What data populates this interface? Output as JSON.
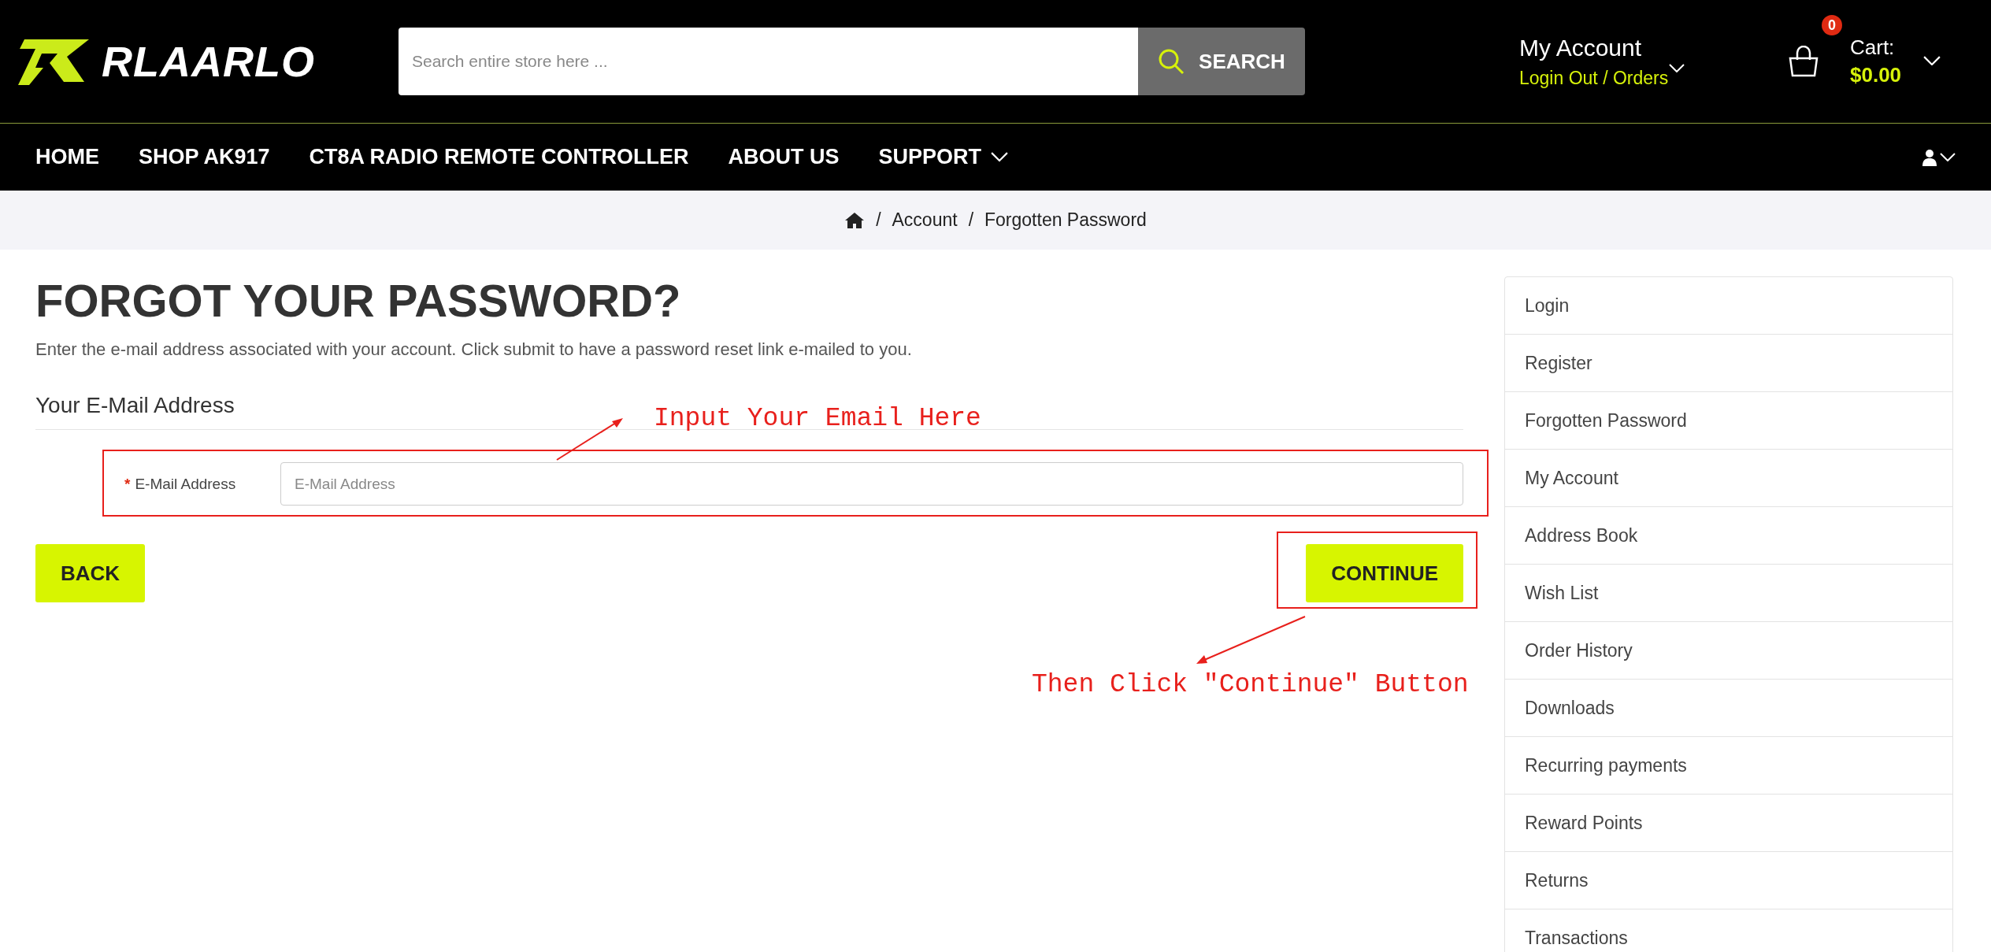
{
  "header": {
    "logo": {
      "text": "RLAARLO"
    },
    "search": {
      "placeholder": "Search entire store here ...",
      "button": "SEARCH"
    },
    "account": {
      "title": "My Account",
      "links": "Login Out / Orders"
    },
    "cart": {
      "count": "0",
      "label": "Cart:",
      "total": "$0.00"
    }
  },
  "nav": {
    "items": [
      {
        "label": "HOME",
        "dropdown": false
      },
      {
        "label": "SHOP AK917",
        "dropdown": false
      },
      {
        "label": "CT8A RADIO REMOTE CONTROLLER",
        "dropdown": false
      },
      {
        "label": "ABOUT US",
        "dropdown": false
      },
      {
        "label": "SUPPORT",
        "dropdown": true
      }
    ]
  },
  "breadcrumb": [
    {
      "separator": "/",
      "label": "Account"
    },
    {
      "separator": "/",
      "label": "Forgotten Password"
    }
  ],
  "page": {
    "title": "FORGOT YOUR PASSWORD?",
    "intro": "Enter the e-mail address associated with your account. Click submit to have a password reset link e-mailed to you.",
    "section": "Your E-Mail Address",
    "field": {
      "required_mark": "*",
      "label": "E-Mail Address",
      "placeholder": "E-Mail Address"
    },
    "buttons": {
      "back": "BACK",
      "continue": "CONTINUE"
    }
  },
  "sidebar": {
    "items": [
      "Login",
      "Register",
      "Forgotten Password",
      "My Account",
      "Address Book",
      "Wish List",
      "Order History",
      "Downloads",
      "Recurring payments",
      "Reward Points",
      "Returns",
      "Transactions"
    ]
  },
  "annotations": [
    {
      "text": "Input Your Email Here"
    },
    {
      "text": "Then Click \"Continue\" Button"
    }
  ]
}
